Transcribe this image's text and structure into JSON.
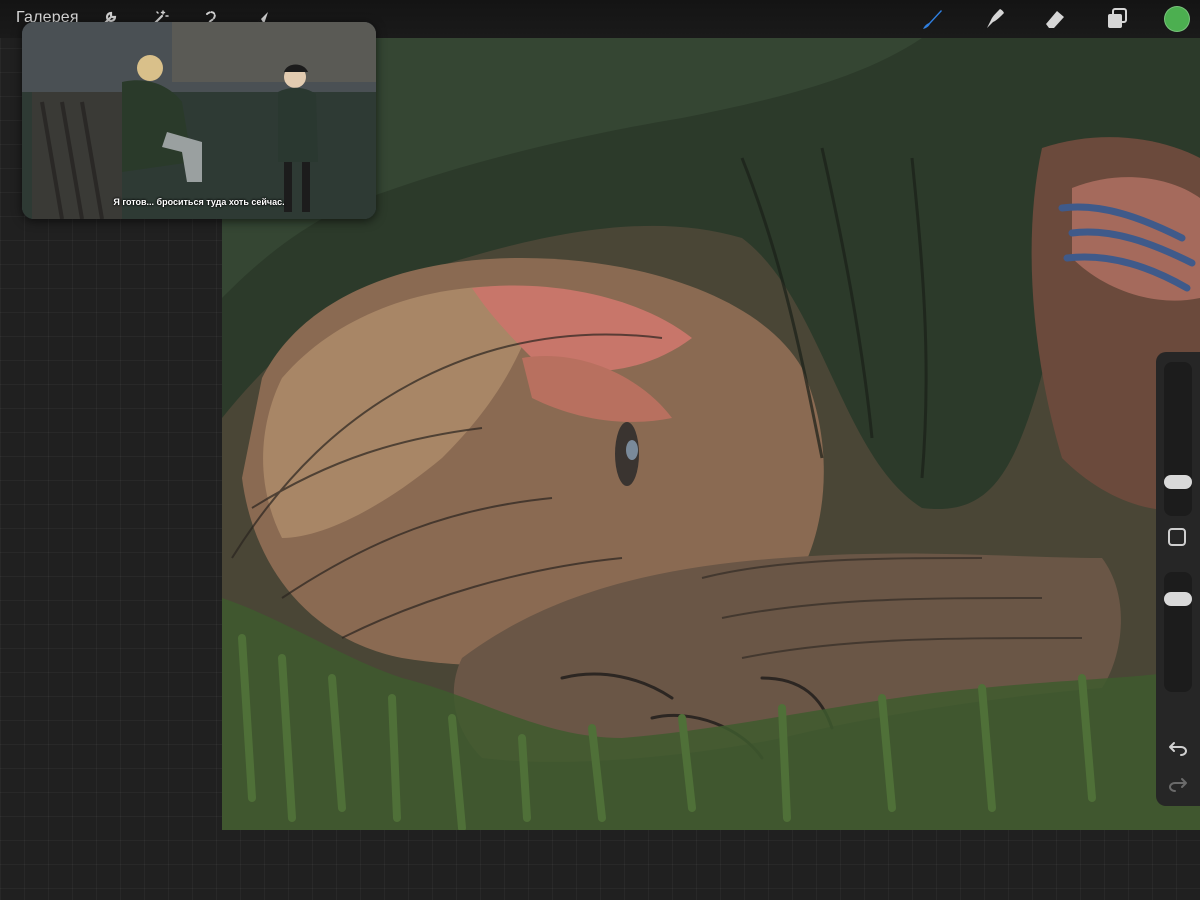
{
  "topbar": {
    "gallery_label": "Галерея",
    "left_tools": [
      "wrench-icon",
      "magic-wand-icon",
      "selection-icon",
      "transform-arrow-icon"
    ],
    "right_tools": [
      "brush-icon",
      "smudge-icon",
      "eraser-icon",
      "layers-icon"
    ],
    "active_tool": "brush-icon",
    "accent_color": "#2f7fe0",
    "current_color": "#4caf50"
  },
  "reference": {
    "subtitle": "Я готов... броситься туда хоть сейчас."
  },
  "sidebar": {
    "icons": [
      "undo-icon",
      "redo-icon"
    ]
  }
}
